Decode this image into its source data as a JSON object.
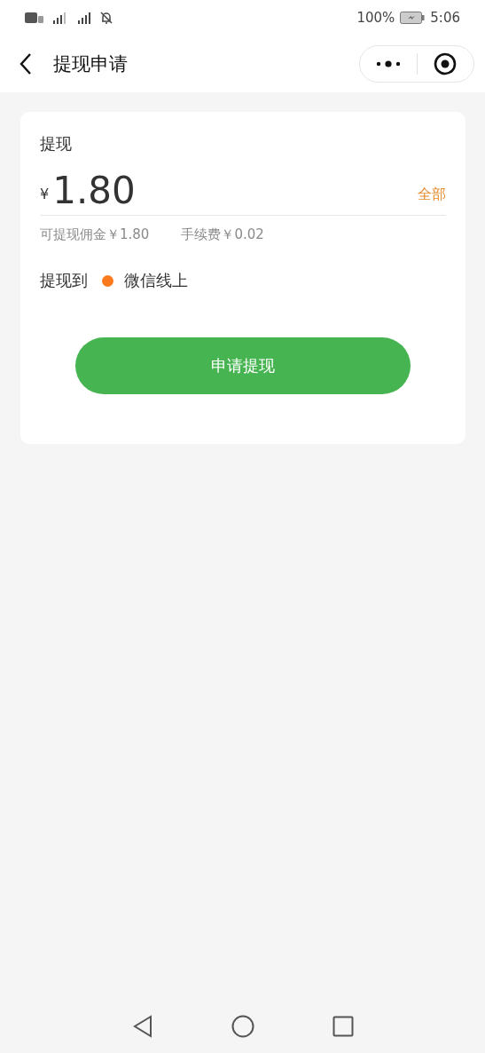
{
  "status_bar": {
    "battery": "100%",
    "time": "5:06"
  },
  "nav": {
    "title": "提现申请"
  },
  "card": {
    "heading": "提现",
    "currency": "¥",
    "amount": "1.80",
    "all_link": "全部",
    "available": "可提现佣金￥1.80",
    "fee": "手续费￥0.02",
    "target_label": "提现到",
    "options": [
      {
        "label": "微信线上",
        "selected": true
      }
    ],
    "submit": "申请提现"
  }
}
